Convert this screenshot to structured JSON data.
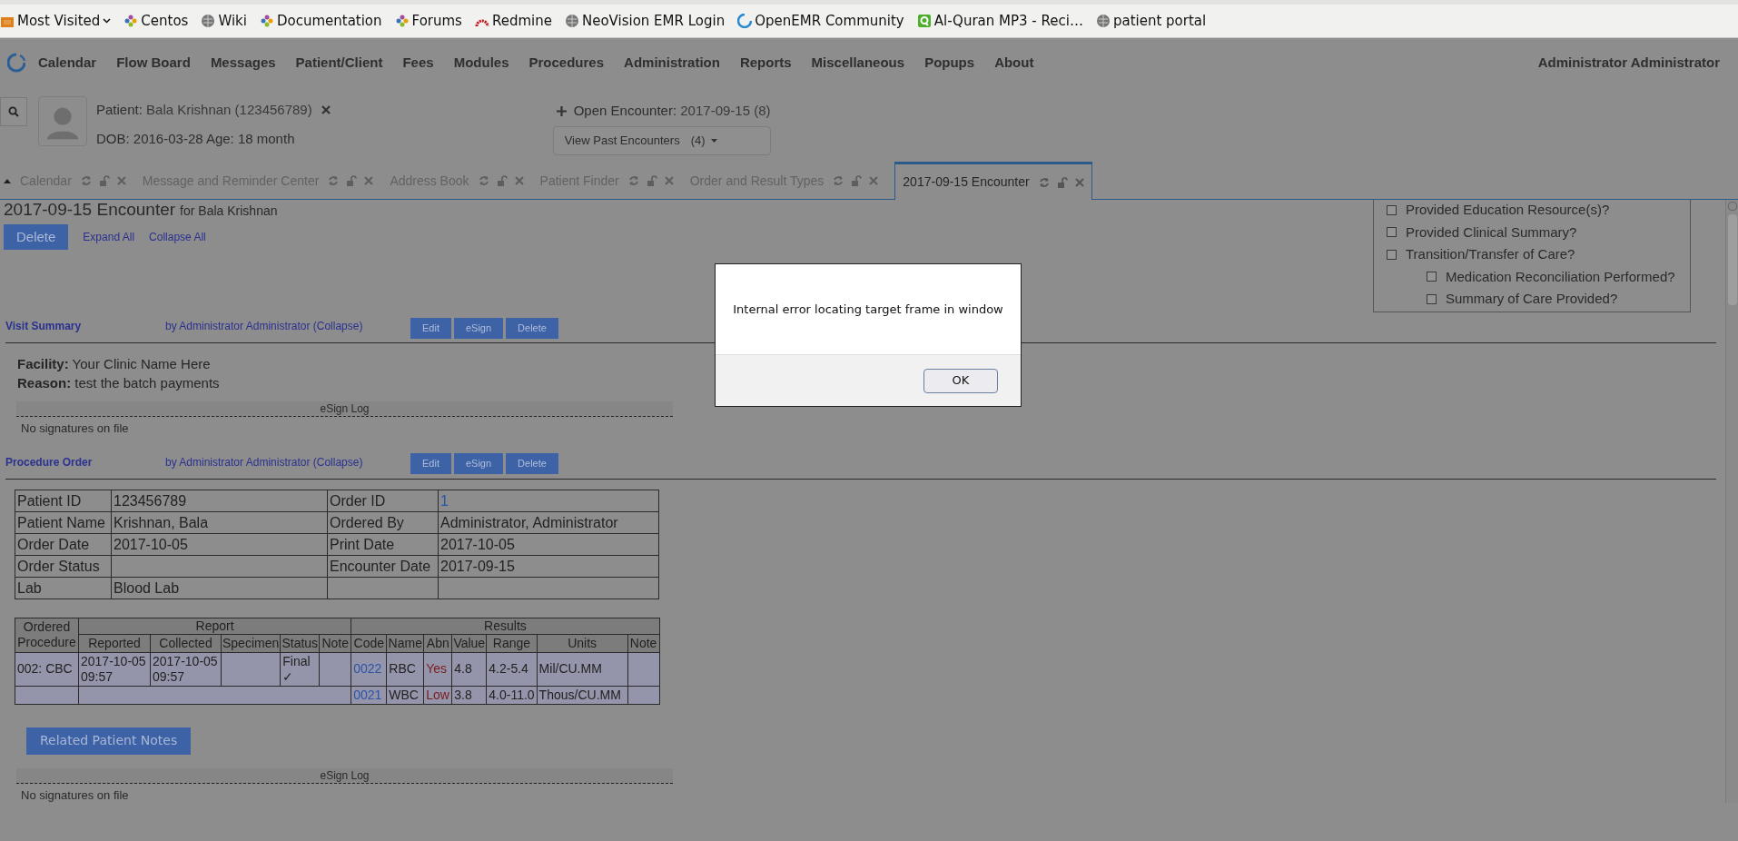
{
  "bookmarks": [
    {
      "label": "Most Visited",
      "kind": "folder"
    },
    {
      "label": "Centos",
      "kind": "flower"
    },
    {
      "label": "Wiki",
      "kind": "globe"
    },
    {
      "label": "Documentation",
      "kind": "flower"
    },
    {
      "label": "Forums",
      "kind": "flower"
    },
    {
      "label": "Redmine",
      "kind": "arc"
    },
    {
      "label": "NeoVision EMR Login",
      "kind": "globe"
    },
    {
      "label": "OpenEMR Community",
      "kind": "ring"
    },
    {
      "label": "Al-Quran MP3 - Reci…",
      "kind": "letter"
    },
    {
      "label": "patient portal",
      "kind": "globe"
    }
  ],
  "menu": [
    "Calendar",
    "Flow Board",
    "Messages",
    "Patient/Client",
    "Fees",
    "Modules",
    "Procedures",
    "Administration",
    "Reports",
    "Miscellaneous",
    "Popups",
    "About"
  ],
  "user": "Administrator Administrator",
  "patient": {
    "label": "Patient:",
    "name": "Bala Krishnan (123456789)",
    "dob": "DOB: 2016-03-28 Age: 18 month"
  },
  "encounter": {
    "label": "Open Encounter:",
    "value": "2017-09-15 (8)",
    "past_button": "View Past Encounters",
    "past_count": "(4)"
  },
  "tabs": [
    {
      "label": "Calendar",
      "selected": false
    },
    {
      "label": "Message and Reminder Center",
      "selected": false
    },
    {
      "label": "Address Book",
      "selected": false
    },
    {
      "label": "Patient Finder",
      "selected": false
    },
    {
      "label": "Order and Result Types",
      "selected": false
    },
    {
      "label": "2017-09-15 Encounter",
      "selected": true
    }
  ],
  "encounter_title": {
    "title": "2017-09-15 Encounter",
    "for": "for Bala Krishnan"
  },
  "actions": {
    "delete": "Delete",
    "expand": "Expand All",
    "collapse": "Collapse All"
  },
  "checklist": [
    {
      "label": "Provided Education Resource(s)?",
      "checked": false
    },
    {
      "label": "Provided Clinical Summary?",
      "checked": false
    },
    {
      "label": "Transition/Transfer of Care?",
      "checked": false,
      "children": [
        {
          "label": "Medication Reconciliation Performed?",
          "checked": false
        },
        {
          "label": "Summary of Care Provided?",
          "checked": false
        }
      ]
    }
  ],
  "sections": [
    {
      "kind": "summary",
      "title": "Visit Summary",
      "author": "by Administrator Administrator (Collapse)",
      "buttons": [
        "Edit",
        "eSign",
        "Delete"
      ],
      "fields": [
        {
          "label": "Facility:",
          "value": "Your Clinic Name Here"
        },
        {
          "label": "Reason:",
          "value": "test the batch payments"
        }
      ],
      "esign": {
        "title": "eSign Log",
        "text": "No signatures on file"
      }
    },
    {
      "kind": "procedure",
      "title": "Procedure Order",
      "author": "by Administrator Administrator (Collapse)",
      "buttons": [
        "Edit",
        "eSign",
        "Delete"
      ],
      "order_table": [
        {
          "left": {
            "label": "Patient ID",
            "value": "123456789"
          },
          "right": {
            "label": "Order ID",
            "value": "1",
            "link": true
          }
        },
        {
          "left": {
            "label": "Patient Name",
            "value": "Krishnan, Bala"
          },
          "right": {
            "label": "Ordered By",
            "value": "Administrator, Administrator"
          }
        },
        {
          "left": {
            "label": "Order Date",
            "value": "2017-10-05"
          },
          "right": {
            "label": "Print Date",
            "value": "2017-10-05"
          }
        },
        {
          "left": {
            "label": "Order Status"
          },
          "right": {
            "label": "Encounter Date",
            "value": "2017-09-15"
          }
        },
        {
          "left": {
            "label": "Lab",
            "value": "Blood Lab"
          }
        }
      ],
      "results_table": {
        "first_header": "Ordered Procedure",
        "groups": [
          {
            "label": "Report",
            "columns": [
              "Reported",
              "Collected",
              "Specimen",
              "Status",
              "Note"
            ]
          },
          {
            "label": "Results",
            "columns": [
              "Code",
              "Name",
              "Abn",
              "Value",
              "Range",
              "Units",
              "Note"
            ]
          }
        ],
        "rows": [
          {
            "procedure": "002: CBC",
            "report": {
              "reported": "2017-10-05 09:57",
              "collected": "2017-10-05 09:57",
              "status": "Final ✓"
            },
            "results": {
              "code": "0022",
              "name": "RBC",
              "abn": "Yes",
              "value": "4.8",
              "range": "4.2-5.4",
              "units": "Mil/CU.MM"
            }
          },
          {
            "results": {
              "code": "0021",
              "name": "WBC",
              "abn": "Low",
              "value": "3.8",
              "range": "4.0-11.0",
              "units": "Thous/CU.MM"
            }
          }
        ]
      },
      "notes_button": "Related Patient Notes",
      "esign": {
        "title": "eSign Log",
        "text": "No signatures on file"
      }
    }
  ],
  "dialog": {
    "message": "Internal error locating target frame in window",
    "button": "OK"
  }
}
